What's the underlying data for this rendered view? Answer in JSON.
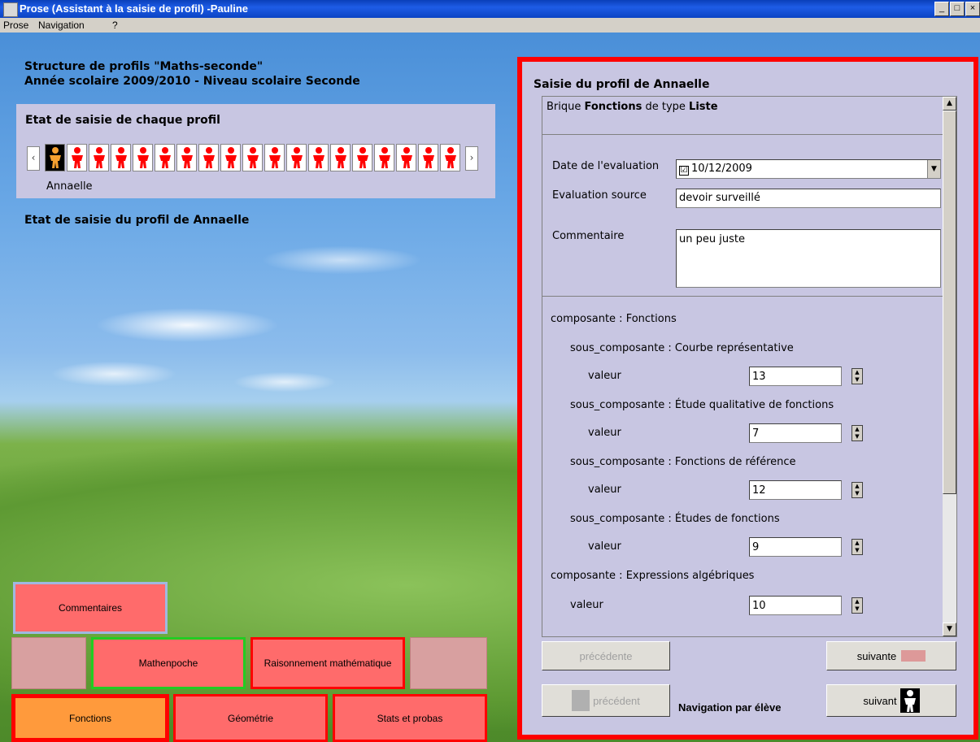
{
  "window": {
    "title": "Prose (Assistant à la saisie de profil) -Pauline",
    "controls": [
      "_",
      "□",
      "×"
    ]
  },
  "menu": [
    "Prose",
    "Navigation",
    "?"
  ],
  "left": {
    "structure_line1": "Structure de profils \"Maths-seconde\"",
    "structure_line2": "Année scolaire 2009/2010 - Niveau scolaire Seconde",
    "state_heading": "Etat de saisie de chaque profil",
    "selected_student": "Annaelle",
    "profile_state_heading": "Etat de saisie du profil de Annaelle",
    "scroll_left": "‹",
    "scroll_right": "›"
  },
  "panel": {
    "title": "Saisie du profil de Annaelle",
    "brique_prefix": "Brique ",
    "brique_name": "Fonctions",
    "brique_mid": " de type ",
    "brique_type": "Liste",
    "date_label": "Date de l'evaluation",
    "date_checked": "☑",
    "date_value": "10/12/2009",
    "source_label": "Evaluation source",
    "source_value": "devoir surveillé",
    "comment_label": "Commentaire",
    "comment_value": "un peu juste",
    "components": [
      {
        "kind": "composante",
        "text": "composante  :  Fonctions"
      },
      {
        "kind": "sous",
        "text": "sous_composante  :  Courbe représentative"
      },
      {
        "kind": "valeur",
        "label": "valeur",
        "value": "13"
      },
      {
        "kind": "sous",
        "text": "sous_composante  :  Étude qualitative de fonctions"
      },
      {
        "kind": "valeur",
        "label": "valeur",
        "value": "7"
      },
      {
        "kind": "sous",
        "text": "sous_composante  :  Fonctions de référence"
      },
      {
        "kind": "valeur",
        "label": "valeur",
        "value": "12"
      },
      {
        "kind": "sous",
        "text": "sous_composante  :  Études de fonctions"
      },
      {
        "kind": "valeur",
        "label": "valeur",
        "value": "9"
      },
      {
        "kind": "composante",
        "text": "composante  :  Expressions algébriques"
      },
      {
        "kind": "valeur2",
        "label": "valeur",
        "value": "10"
      }
    ],
    "prev_label": "précédente",
    "next_label": "suivante",
    "prev_student": "précédent",
    "nav_student_label": "Navigation par élève",
    "next_student": "suivant"
  },
  "tiles": {
    "commentaires": "Commentaires",
    "mathenpoche": "Mathenpoche",
    "raisonnement": "Raisonnement mathématique",
    "fonctions": "Fonctions",
    "geometrie": "Géométrie",
    "stats": "Stats et probas"
  },
  "colors": {
    "accent_red": "#ff0000",
    "tile_red": "#ff6b6b",
    "tile_orange": "#ff9a3c",
    "panel_bg": "#c8c6e2",
    "green_border": "#22cc22"
  }
}
